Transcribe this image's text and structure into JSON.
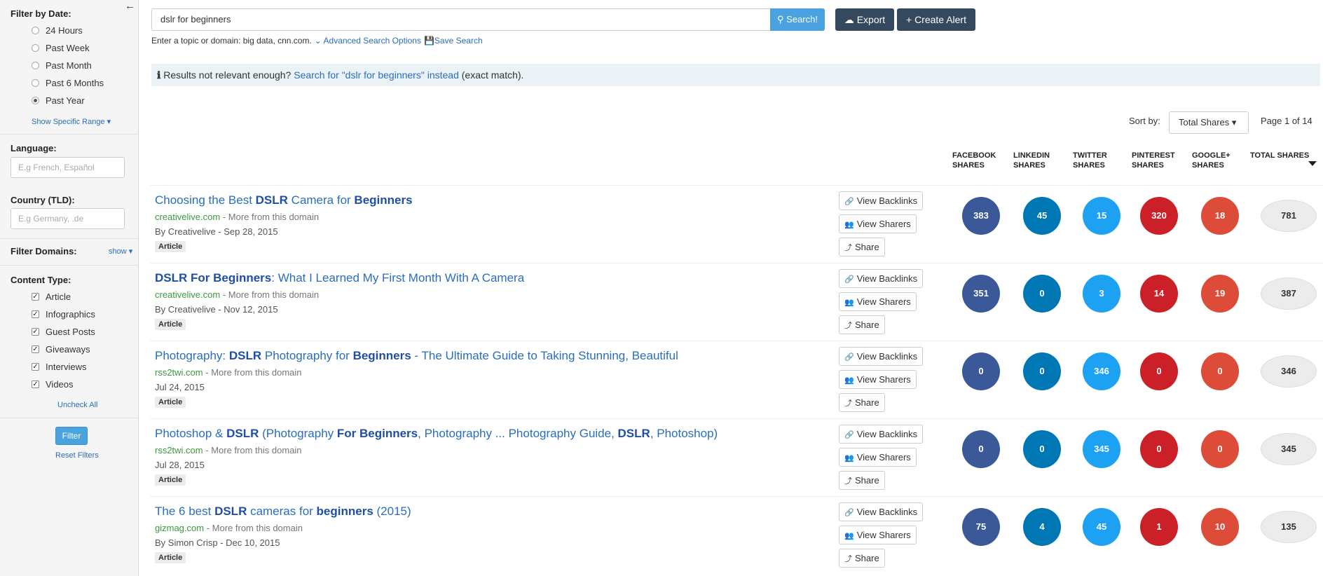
{
  "sidebar": {
    "date_heading": "Filter by Date:",
    "date_options": [
      "24 Hours",
      "Past Week",
      "Past Month",
      "Past 6 Months",
      "Past Year"
    ],
    "date_selected": "Past Year",
    "show_range": "Show Specific Range",
    "language_label": "Language:",
    "language_placeholder": "E.g French, Español",
    "country_label": "Country (TLD):",
    "country_placeholder": "E.g Germany, .de",
    "filter_domains_label": "Filter Domains:",
    "filter_domains_show": "show",
    "content_type_label": "Content Type:",
    "content_types": [
      "Article",
      "Infographics",
      "Guest Posts",
      "Giveaways",
      "Interviews",
      "Videos"
    ],
    "uncheck_all": "Uncheck All",
    "filter_button": "Filter",
    "reset_filters": "Reset Filters"
  },
  "search": {
    "query": "dslr for beginners",
    "search_button": "Search!",
    "export_button": "Export",
    "create_alert_button": "Create Alert",
    "helper_text": "Enter a topic or domain: big data, cnn.com.",
    "advanced_link": "Advanced Search Options",
    "save_link": "Save Search"
  },
  "notice": {
    "prefix": "Results not relevant enough?",
    "link": "Search for \"dslr for beginners\" instead",
    "suffix": "(exact match)."
  },
  "sort": {
    "label": "Sort by:",
    "value": "Total Shares",
    "page_info": "Page 1 of 14"
  },
  "columns": [
    [
      "FACEBOOK",
      "SHARES"
    ],
    [
      "LINKEDIN",
      "SHARES"
    ],
    [
      "TWITTER",
      "SHARES"
    ],
    [
      "PINTEREST",
      "SHARES"
    ],
    [
      "GOOGLE+",
      "SHARES"
    ],
    [
      "TOTAL SHARES",
      ""
    ]
  ],
  "actions": {
    "backlinks": "View Backlinks",
    "sharers": "View Sharers",
    "share": "Share"
  },
  "more_from_domain": "- More from this domain",
  "results": [
    {
      "title_parts": [
        [
          "n",
          "Choosing the Best "
        ],
        [
          "b",
          "DSLR"
        ],
        [
          "n",
          " Camera for "
        ],
        [
          "b",
          "Beginners"
        ]
      ],
      "domain": "creativelive.com",
      "meta": "By Creativelive - Sep 28, 2015",
      "type": "Article",
      "shares": {
        "facebook": "383",
        "linkedin": "45",
        "twitter": "15",
        "pinterest": "320",
        "googleplus": "18",
        "total": "781"
      }
    },
    {
      "title_parts": [
        [
          "b",
          "DSLR For Beginners"
        ],
        [
          "n",
          ": What I Learned My First Month With A Camera"
        ]
      ],
      "domain": "creativelive.com",
      "meta": "By Creativelive - Nov 12, 2015",
      "type": "Article",
      "shares": {
        "facebook": "351",
        "linkedin": "0",
        "twitter": "3",
        "pinterest": "14",
        "googleplus": "19",
        "total": "387"
      }
    },
    {
      "title_parts": [
        [
          "n",
          "Photography: "
        ],
        [
          "b",
          "DSLR"
        ],
        [
          "n",
          " Photography for "
        ],
        [
          "b",
          "Beginners"
        ],
        [
          "n",
          " - The Ultimate Guide to Taking Stunning, Beautiful"
        ]
      ],
      "domain": "rss2twi.com",
      "meta": "Jul 24, 2015",
      "type": "Article",
      "shares": {
        "facebook": "0",
        "linkedin": "0",
        "twitter": "346",
        "pinterest": "0",
        "googleplus": "0",
        "total": "346"
      }
    },
    {
      "title_parts": [
        [
          "n",
          "Photoshop & "
        ],
        [
          "b",
          "DSLR"
        ],
        [
          "n",
          " (Photography "
        ],
        [
          "b",
          "For Beginners"
        ],
        [
          "n",
          ", Photography ... Photography Guide, "
        ],
        [
          "b",
          "DSLR"
        ],
        [
          "n",
          ", Photoshop)"
        ]
      ],
      "domain": "rss2twi.com",
      "meta": "Jul 28, 2015",
      "type": "Article",
      "shares": {
        "facebook": "0",
        "linkedin": "0",
        "twitter": "345",
        "pinterest": "0",
        "googleplus": "0",
        "total": "345"
      }
    },
    {
      "title_parts": [
        [
          "n",
          "The 6 best "
        ],
        [
          "b",
          "DSLR"
        ],
        [
          "n",
          " cameras for "
        ],
        [
          "b",
          "beginners"
        ],
        [
          "n",
          " (2015)"
        ]
      ],
      "domain": "gizmag.com",
      "meta": "By Simon Crisp - Dec 10, 2015",
      "type": "Article",
      "shares": {
        "facebook": "75",
        "linkedin": "4",
        "twitter": "45",
        "pinterest": "1",
        "googleplus": "10",
        "total": "135"
      }
    }
  ]
}
